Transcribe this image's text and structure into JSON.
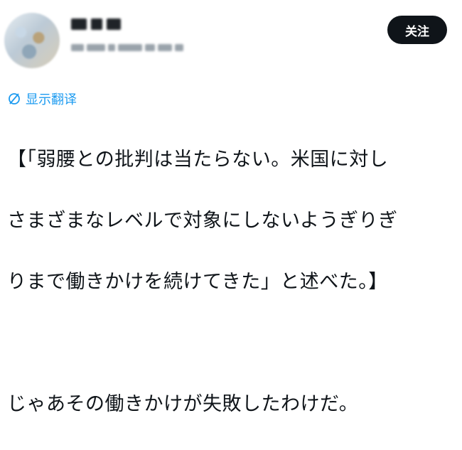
{
  "header": {
    "follow_label": "关注"
  },
  "translate": {
    "label": "显示翻译",
    "icon": "globe-slash-icon"
  },
  "post": {
    "line1": "【「弱腰との批判は当たらない。米国に対し",
    "line2": "さまざまなレベルで対象にしないようぎりぎ",
    "line3": "りまで働きかけを続けてきた」と述べた。】",
    "line4": "じゃあその働きかけが失敗したわけだ。"
  },
  "colors": {
    "link": "#1d9bf0",
    "button_bg": "#0f1419",
    "text": "#0f1419"
  }
}
